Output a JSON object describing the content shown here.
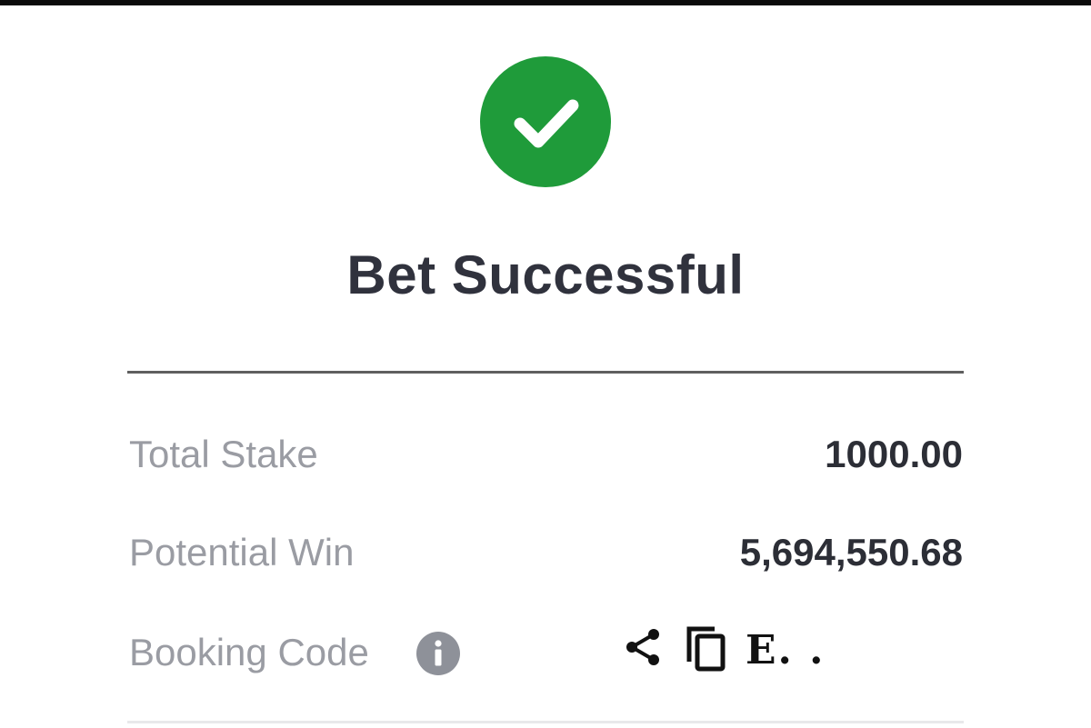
{
  "dialog": {
    "title": "Bet Successful",
    "status_icon": "check-circle-icon",
    "accent_color": "#1f9b3a"
  },
  "details": {
    "total_stake": {
      "label": "Total Stake",
      "value": "1000.00"
    },
    "potential_win": {
      "label": "Potential Win",
      "value": "5,694,550.68"
    },
    "booking_code": {
      "label": "Booking Code",
      "info_icon": "info-icon",
      "share_icon": "share-icon",
      "copy_icon": "copy-icon",
      "value": "E. ."
    }
  }
}
